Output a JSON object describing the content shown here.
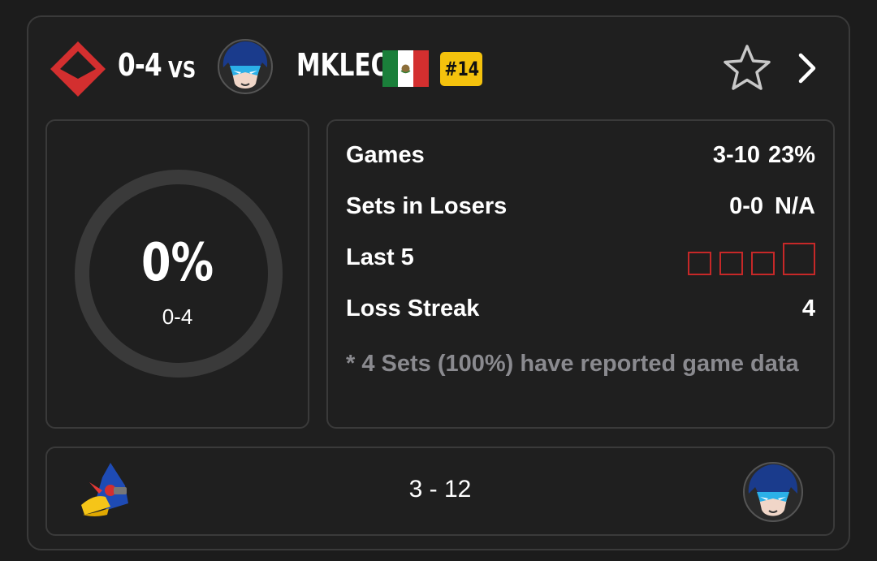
{
  "header": {
    "record": "0-4",
    "vs_label": "VS",
    "opponent_name": "MKLEO",
    "rank": "#14",
    "icons": [
      "player-logo-icon",
      "opponent-avatar-icon",
      "mexico-flag-icon",
      "star-icon",
      "chevron-right-icon"
    ]
  },
  "winrate": {
    "percent": "0%",
    "record": "0-4",
    "fraction": 0
  },
  "stats": {
    "games_label": "Games",
    "games_value": "3-10",
    "games_pct": "23%",
    "losers_label": "Sets in Losers",
    "losers_value": "0-0",
    "losers_pct": "N/A",
    "last5_label": "Last 5",
    "last5_results": [
      "L",
      "L",
      "L",
      "L"
    ],
    "streak_label": "Loss Streak",
    "streak_value": "4",
    "note": "* 4 Sets (100%) have reported game data"
  },
  "matchup": {
    "score": "3 - 12",
    "left_character": "falco-icon",
    "right_character": "joker-icon"
  },
  "colors": {
    "loss": "#c62828",
    "rank_badge": "#f4c20d",
    "ring": "#3a3a3a",
    "muted_text": "#8a8a8f"
  }
}
